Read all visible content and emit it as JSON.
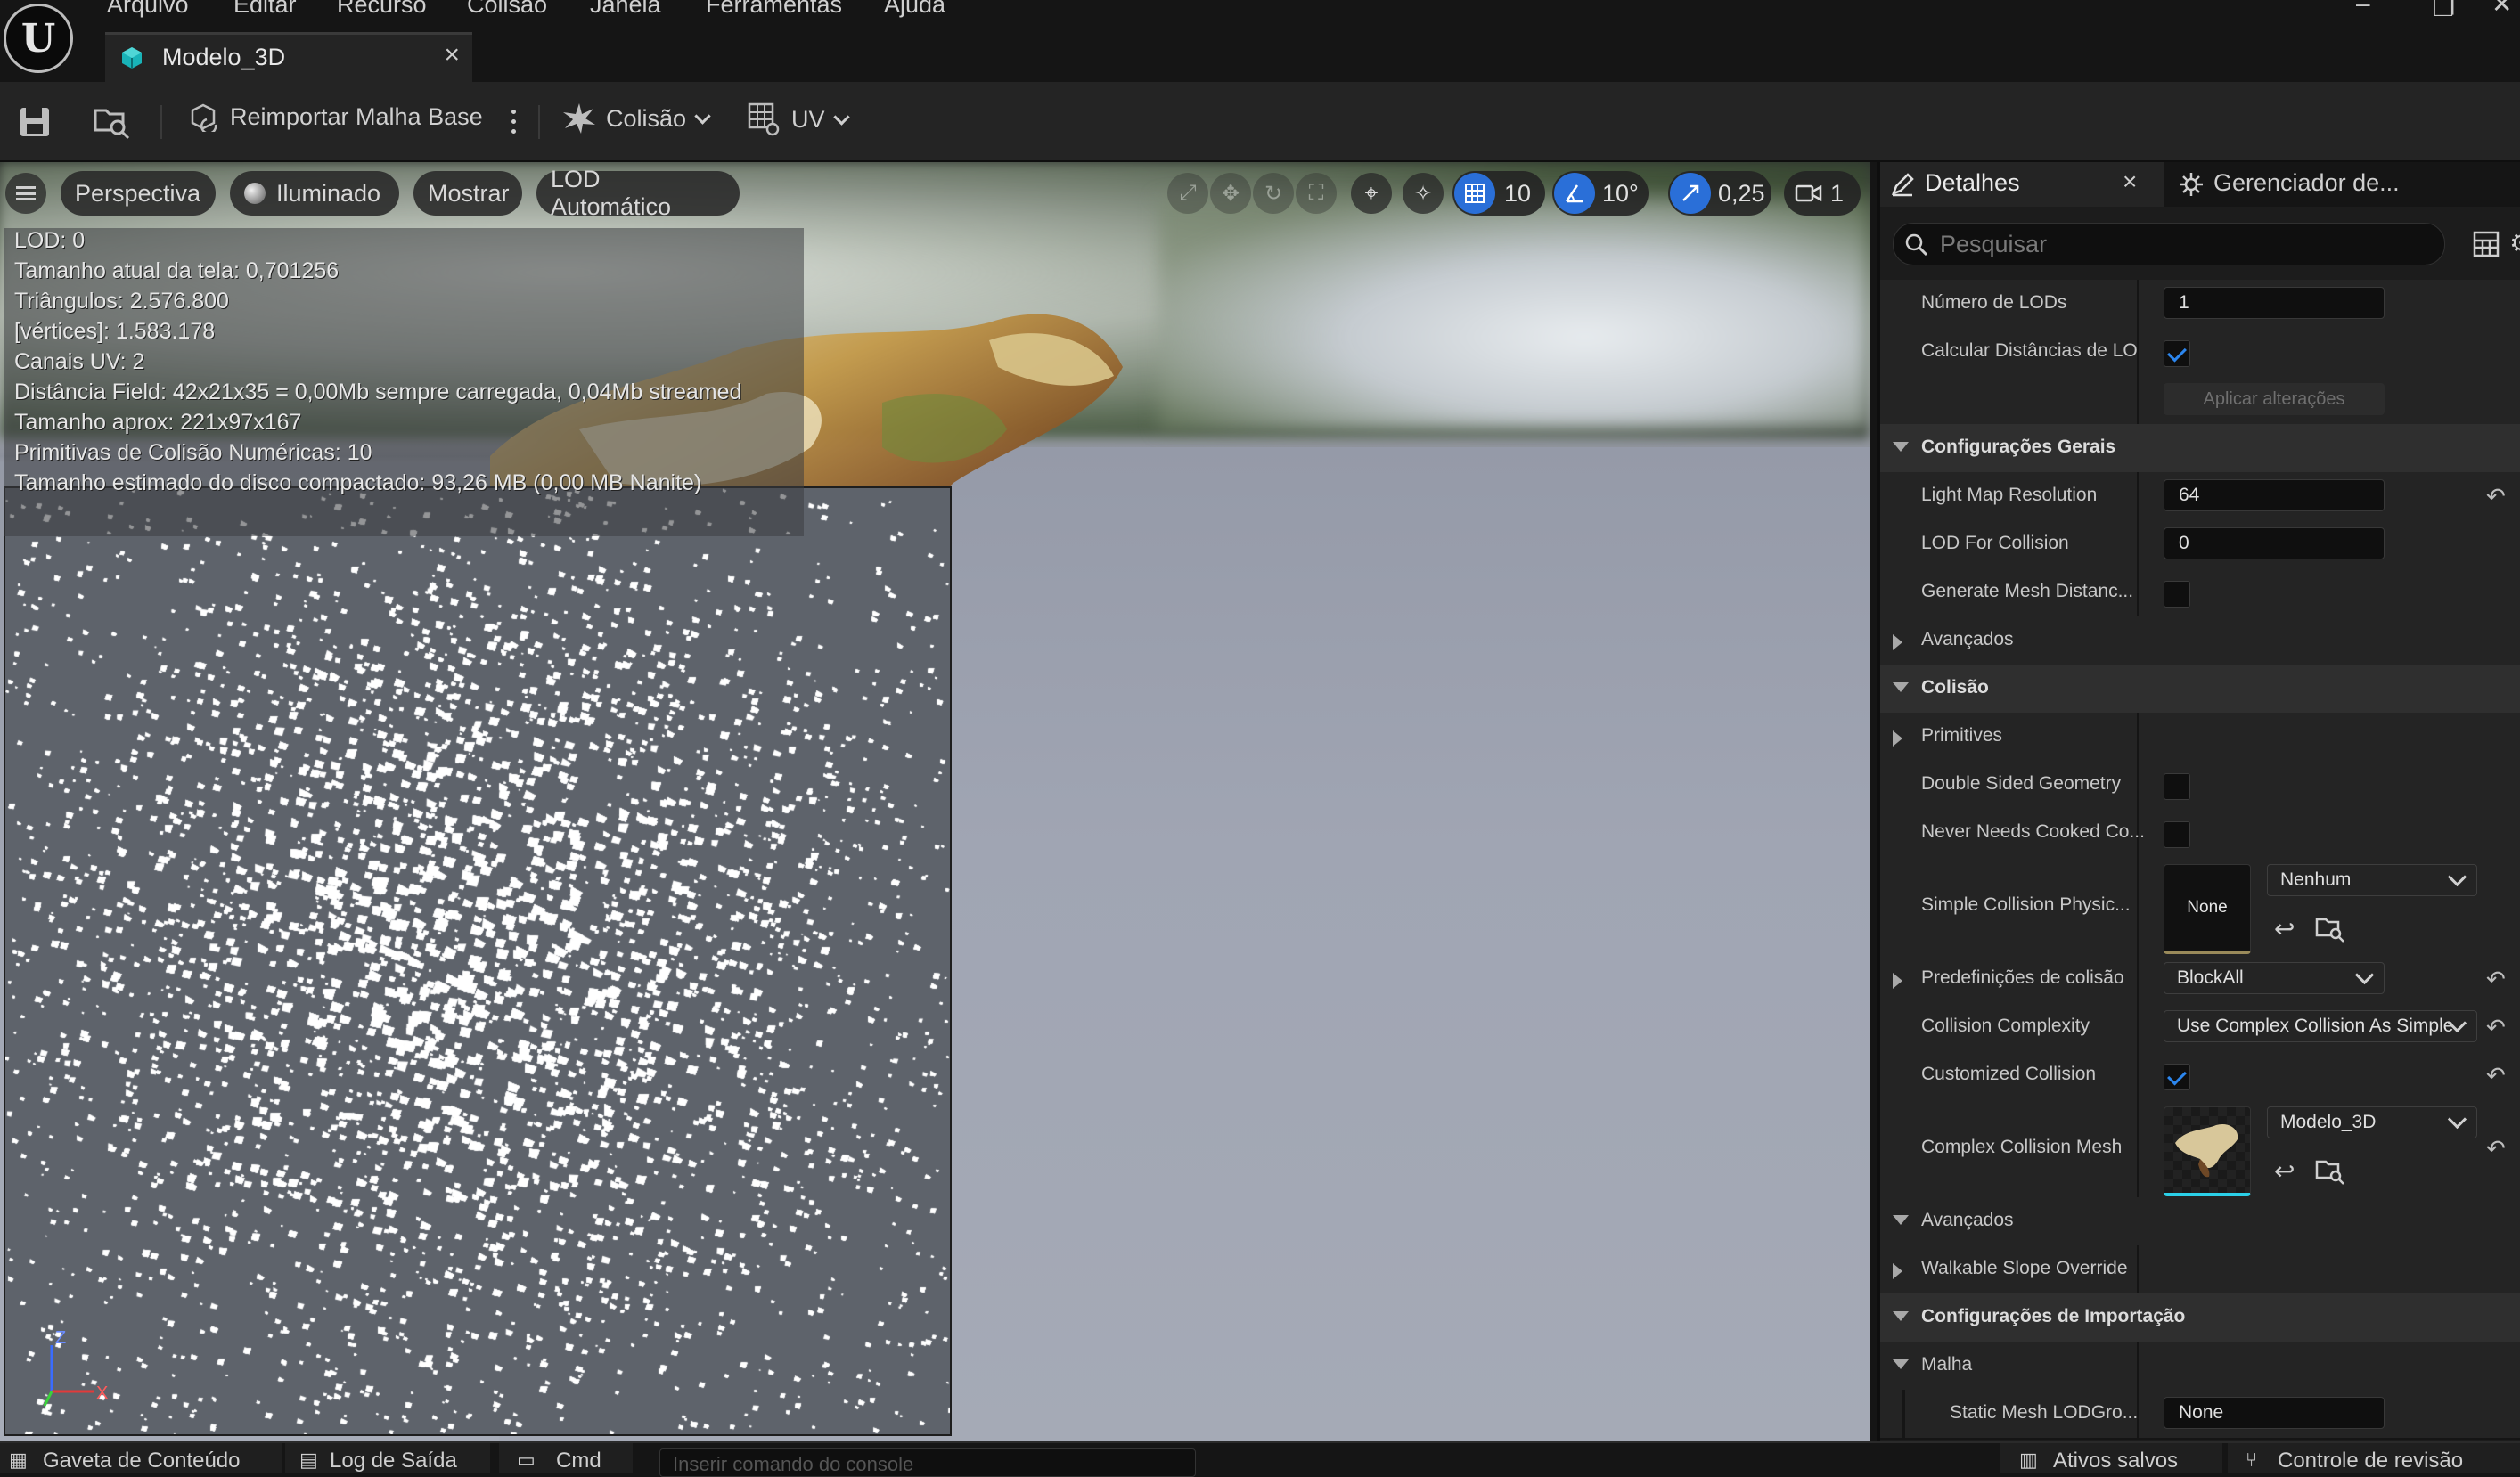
{
  "menu": [
    "Arquivo",
    "Editar",
    "Recurso",
    "Colisão",
    "Janela",
    "Ferramentas",
    "Ajuda"
  ],
  "tab": {
    "label": "Modelo_3D",
    "close": "×",
    "icon": "static-mesh-icon"
  },
  "toolbar": {
    "reimport": "Reimportar Malha Base",
    "collision": "Colisão",
    "uv": "UV"
  },
  "viewport": {
    "buttons": {
      "perspective": "Perspectiva",
      "lit": "Iluminado",
      "show": "Mostrar",
      "lod": "LOD Automático"
    },
    "grid": "10",
    "angle": "10°",
    "scale": "0,25",
    "camera": "1",
    "stats": [
      "LOD:  0",
      "Tamanho atual da tela: 0,701256",
      "Triângulos:  2.576.800",
      "[vértices]:  1.583.178",
      "Canais UV:  2",
      "Distância Field:  42x21x35 = 0,00Mb sempre carregada, 0,04Mb streamed",
      "Tamanho aprox: 221x97x167",
      "Primitivas de Colisão Numéricas: 10",
      "Tamanho estimado do disco compactado: 93,26 MB (0,00 MB Nanite)"
    ],
    "axes": {
      "z": "Z",
      "x": "X"
    }
  },
  "details": {
    "tab": "Detalhes",
    "tab_close": "×",
    "tab2": "Gerenciador de...",
    "search_placeholder": "Pesquisar",
    "rows": {
      "num_lods": {
        "label": "Número de LODs",
        "value": "1"
      },
      "calc_lod": {
        "label": "Calcular Distâncias de LO",
        "checked": true
      },
      "apply": "Aplicar alterações",
      "cat_general": "Configurações Gerais",
      "lightmap": {
        "label": "Light Map Resolution",
        "value": "64"
      },
      "lod_collision": {
        "label": "LOD For Collision",
        "value": "0"
      },
      "gen_mesh": {
        "label": "Generate Mesh Distanc...",
        "checked": false
      },
      "advanced1": "Avançados",
      "cat_collision": "Colisão",
      "primitives": "Primitives",
      "double_sided": {
        "label": "Double Sided Geometry",
        "checked": false
      },
      "never_cooked": {
        "label": "Never Needs Cooked Co...",
        "checked": false
      },
      "simple_phys": {
        "label": "Simple Collision Physic...",
        "thumb": "None",
        "value": "Nenhum"
      },
      "presets": {
        "label": "Predefinições de colisão",
        "value": "BlockAll"
      },
      "complexity": {
        "label": "Collision Complexity",
        "value": "Use Complex Collision As Simple"
      },
      "customized": {
        "label": "Customized Collision",
        "checked": true
      },
      "complex_mesh": {
        "label": "Complex Collision Mesh",
        "value": "Modelo_3D"
      },
      "advanced2": "Avançados",
      "walkable": "Walkable Slope Override",
      "cat_import": "Configurações de Importação",
      "mesh": "Malha",
      "lodgroup": {
        "label": "Static Mesh LODGro...",
        "value": "None"
      }
    }
  },
  "statusbar": [
    "Gaveta de Conteúdo",
    "Log de Saída",
    "Cmd",
    "Inserir comando do console",
    "Ativos salvos",
    "Controle de revisão"
  ],
  "colors": {
    "accent": "#2a6fd8",
    "check": "#2c86ee",
    "panel": "#242424",
    "category": "#2f2f2f"
  }
}
